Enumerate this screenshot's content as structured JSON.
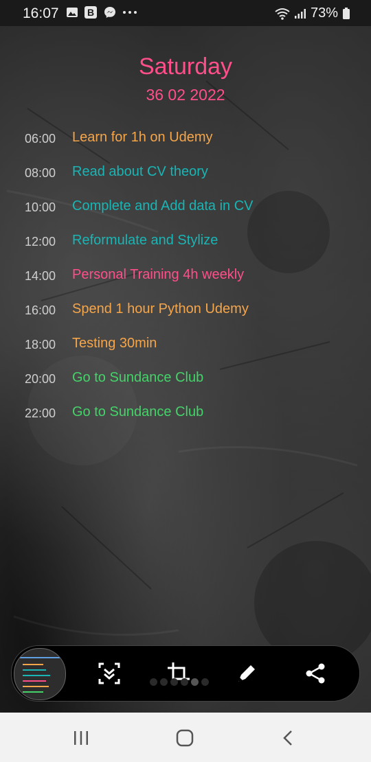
{
  "status": {
    "time": "16:07",
    "battery": "73%",
    "left_icons": [
      "image-icon",
      "b-app-icon",
      "messenger-icon",
      "more-dots-icon"
    ],
    "right_icons": [
      "wifi-icon",
      "signal-icon",
      "battery-icon"
    ]
  },
  "header": {
    "day": "Saturday",
    "date": "36 02 2022"
  },
  "colors": {
    "pink": "#ff4f8b",
    "orange": "#f6a64a",
    "teal": "#1ab5b5",
    "green": "#45d36a"
  },
  "schedule": [
    {
      "time": "06:00",
      "task": "Learn for 1h on Udemy",
      "color": "#f6a64a"
    },
    {
      "time": "08:00",
      "task": "Read about CV theory",
      "color": "#1ab5b5"
    },
    {
      "time": "10:00",
      "task": "Complete and Add data in CV",
      "color": "#1ab5b5"
    },
    {
      "time": "12:00",
      "task": "Reformulate and Stylize",
      "color": "#1ab5b5"
    },
    {
      "time": "14:00",
      "task": "Personal Training 4h weekly",
      "color": "#ff4f8b"
    },
    {
      "time": "16:00",
      "task": "Spend 1 hour Python Udemy",
      "color": "#f6a64a"
    },
    {
      "time": "18:00",
      "task": "Testing 30min",
      "color": "#f6a64a"
    },
    {
      "time": "20:00",
      "task": "Go to Sundance Club",
      "color": "#45d36a"
    },
    {
      "time": "22:00",
      "task": "Go to Sundance Club",
      "color": "#45d36a"
    }
  ],
  "toolbar": {
    "items": [
      "screenshot-thumbnail",
      "scroll-capture-icon",
      "crop-icon",
      "draw-icon",
      "share-icon"
    ],
    "page_dots": 6,
    "active_dot": 4
  },
  "navbar": {
    "items": [
      "recents-icon",
      "home-icon",
      "back-icon"
    ]
  }
}
